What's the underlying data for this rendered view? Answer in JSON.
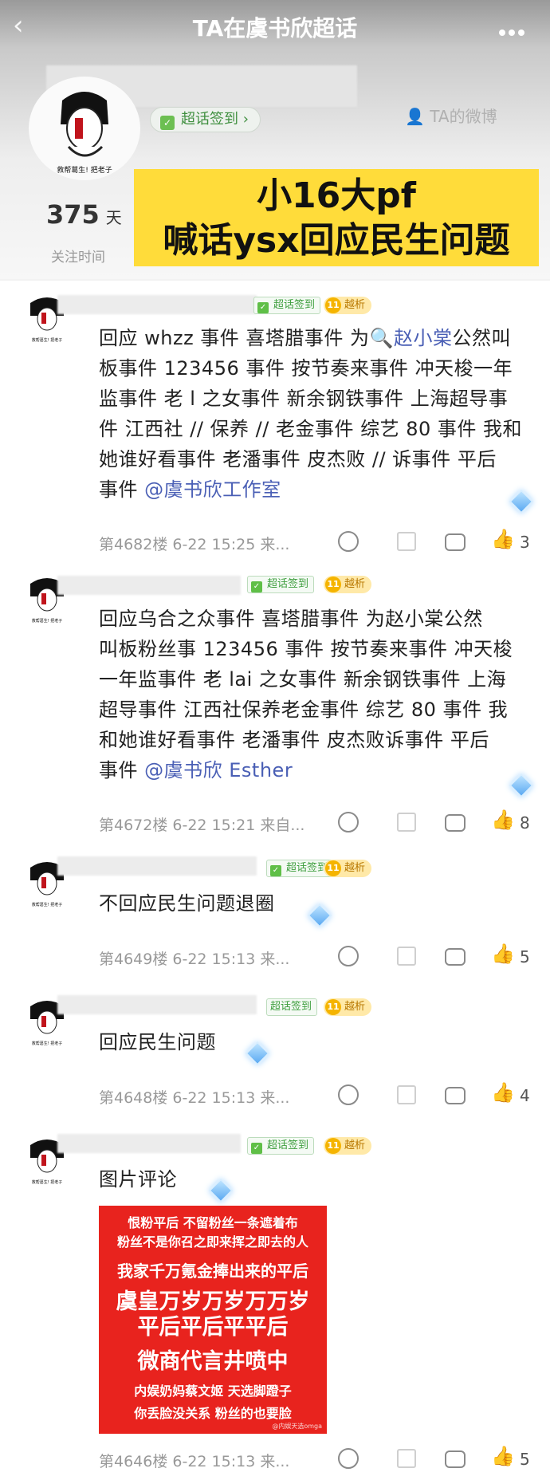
{
  "nav": {
    "back_icon": "‹",
    "title": "TA在虞书欣超话"
  },
  "profile": {
    "checkin_label": "超话签到 ›",
    "weibo_label": "TA的微博",
    "days_value": "375",
    "days_unit": "天",
    "follow_label": "关注时间",
    "avatar_caption": "救帮葛生! 把老子"
  },
  "banner": {
    "line1": "小16大pf",
    "line2": "喊话ysx回应民生问题"
  },
  "badges": {
    "checkin": "超话签到",
    "rank": "越析"
  },
  "comments": [
    {
      "lines": [
        "回应 whzz 事件 喜塔腊事件 为",
        "板事件 123456 事件 按节奏来事件 冲天梭一年",
        "监事件 老 l 之女事件 新余钢铁事件 上海超导事",
        "件 江西社 // 保养 // 老金事件 综艺 80 事件 我和",
        "她谁好看事件 老潘事件 皮杰败 // 诉事件 平后",
        "事件"
      ],
      "mention1": "赵小棠",
      "tail1": "公然叫",
      "mention2": "@虞书欣工作室",
      "meta": "第4682楼 6-22 15:25 来...",
      "likes": "3"
    },
    {
      "lines": [
        "回应乌合之众事件 喜塔腊事件 为赵小棠公然",
        "叫板粉丝事 123456 事件 按节奏来事件 冲天梭",
        "一年监事件 老 lai 之女事件 新余钢铁事件 上海",
        "超导事件 江西社保养老金事件 综艺 80 事件 我",
        "和她谁好看事件 老潘事件 皮杰败诉事件 平后",
        "事件"
      ],
      "mention2": "@虞书欣 Esther",
      "meta": "第4672楼 6-22 15:21 来自...",
      "likes": "8"
    },
    {
      "lines": [
        "不回应民生问题退圈"
      ],
      "meta": "第4649楼 6-22 15:13 来...",
      "likes": "5"
    },
    {
      "lines": [
        "回应民生问题"
      ],
      "meta": "第4648楼 6-22 15:13 来...",
      "likes": "4"
    },
    {
      "lines": [
        "图片评论"
      ],
      "meta": "第4646楼 6-22 15:13 来...",
      "likes": "5"
    }
  ],
  "image_text": [
    "恨粉平后 不留粉丝一条遮着布",
    "粉丝不是你召之即来挥之即去的人",
    "我家千万氪金捧出来的平后",
    "虞皇万岁万岁万万岁",
    "平后平后平平后",
    "微商代言井喷中",
    "内娱奶妈蔡文姬 天选脚蹬子",
    "你丢脸没关系 粉丝的也要脸",
    "@内娱天选omga"
  ]
}
